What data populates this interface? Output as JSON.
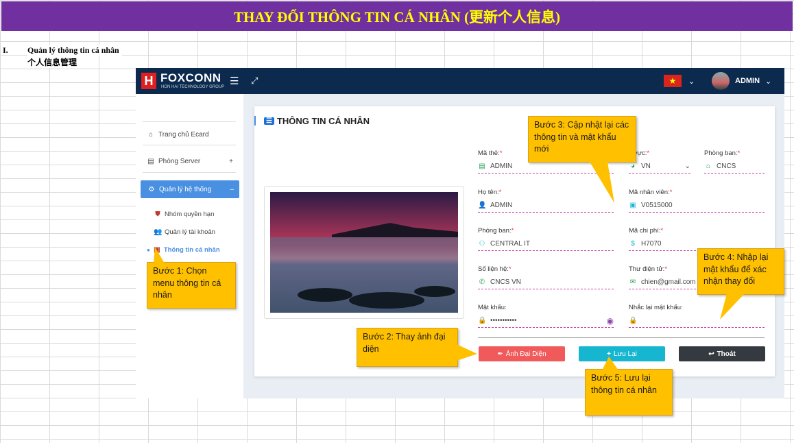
{
  "banner": {
    "title": "THAY ĐỔI THÔNG TIN CÁ NHÂN (更新个人信息)"
  },
  "section": {
    "number": "I.",
    "title": "Quản lý thông tin cá nhân",
    "title_cn": "个人信息管理"
  },
  "topbar": {
    "brand": "FOXCONN",
    "brand_sub": "HON HAI TECHNOLOGY GROUP",
    "logo": "H",
    "user": "ADMIN"
  },
  "sidebar": {
    "items": [
      {
        "label": "Trang chủ Ecard",
        "icon": "home-icon"
      },
      {
        "label": "Phòng Server",
        "icon": "server-icon",
        "suffix": "+"
      },
      {
        "label": "Quản lý hệ thống",
        "icon": "gear-icon",
        "suffix": "–",
        "active": true
      }
    ],
    "subitems": [
      {
        "label": "Nhóm quyền hạn",
        "icon": "shield-icon"
      },
      {
        "label": "Quản lý tài khoản",
        "icon": "users-icon"
      },
      {
        "label": "Thông tin cá nhân",
        "icon": "id-card-icon",
        "active": true
      }
    ]
  },
  "card": {
    "title": "THÔNG TIN CÁ NHÂN",
    "fields": {
      "ma_the": {
        "label": "Mã thẻ:",
        "value": "ADMIN"
      },
      "khu_vuc": {
        "label": "u vực:",
        "value": "VN"
      },
      "phong_ban_top": {
        "label": "Phòng ban:",
        "value": "CNCS"
      },
      "ho_ten": {
        "label": "Họ tên:",
        "value": "ADMIN"
      },
      "ma_nhan_vien": {
        "label": "Mã nhân viên:",
        "value": "V0515000"
      },
      "phong_ban": {
        "label": "Phòng ban:",
        "value": "CENTRAL IT"
      },
      "ma_chi_phi": {
        "label": "Mã chi phí:",
        "value": "H7070"
      },
      "so_lien_he": {
        "label": "Số liện hệ:",
        "value": "CNCS VN"
      },
      "thu_dien_tu": {
        "label": "Thư điện tử:",
        "value": "chien@gmail.com"
      },
      "mat_khau": {
        "label": "Mật khẩu:",
        "value": "•••••••••••"
      },
      "nhac_lai": {
        "label": "Nhắc lại mật khẩu:",
        "value": ""
      }
    },
    "buttons": {
      "avatar": "Ảnh Đại Diện",
      "save": "Lưu Lại",
      "exit": "Thoát"
    }
  },
  "callouts": {
    "step1": "Bước 1: Chọn menu thông tin cá nhân",
    "step2": "Bước 2: Thay ảnh đại diện",
    "step3": "Bước 3: Cập nhật lại các thông tin và mật khẩu mới",
    "step4": "Bước 4: Nhập lại mật khẩu để xác nhận thay đổi",
    "step5": "Bước 5: Lưu lại thông tin  cá nhân"
  },
  "colors": {
    "banner_bg": "#7030a0",
    "banner_text": "#ffff00",
    "topbar": "#0b2a4e",
    "callout": "#ffc000",
    "avatar_btn": "#f05a5a",
    "save_btn": "#17b6d0",
    "exit_btn": "#343a40"
  }
}
